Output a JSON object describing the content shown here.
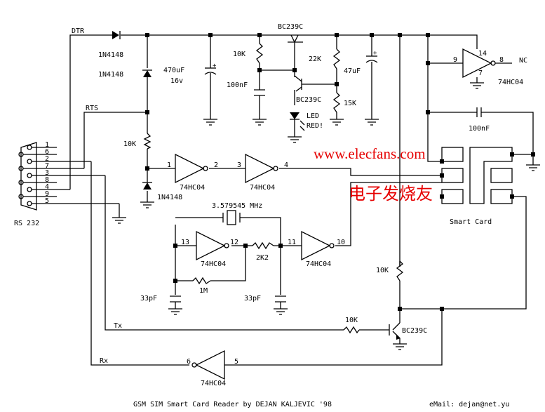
{
  "title": "GSM SIM Smart Card Reader by DEJAN KALJEVIC '98",
  "email": "eMail: dejan@net.yu",
  "watermark": {
    "url": "www.elecfans.com",
    "cn": "电子发烧友",
    "color": "#e60000"
  },
  "signals": {
    "dtr": "DTR",
    "rts": "RTS",
    "tx": "Tx",
    "rx": "Rx"
  },
  "connector": {
    "label": "RS 232",
    "pins": [
      "1",
      "6",
      "2",
      "7",
      "3",
      "8",
      "4",
      "9",
      "5"
    ]
  },
  "components": {
    "d1": "1N4148",
    "d2": "1N4148",
    "d3": "1N4148",
    "c_470": "470uF",
    "c_470_v": "16v",
    "r_10k_top": "10K",
    "c_100n_top": "100nF",
    "q1": "BC239C",
    "q2": "BC239C",
    "r_22k": "22K",
    "r_15k": "15K",
    "c_47u": "47uF",
    "led": "LED",
    "led_color": "RED!",
    "r_10k_rts": "10K",
    "crystal": "3.579545 MHz",
    "r_2k2": "2K2",
    "r_1m": "1M",
    "c_33p_a": "33pF",
    "c_33p_b": "33pF",
    "r_10k_mid": "10K",
    "r_10k_tx": "10K",
    "q3": "BC239C",
    "c_100n_right": "100nF",
    "smart_card": "Smart Card",
    "nc": "NC"
  },
  "gates": [
    {
      "part": "74HC04",
      "in": "1",
      "out": "2"
    },
    {
      "part": "74HC04",
      "in": "3",
      "out": "4"
    },
    {
      "part": "74HC04",
      "in": "13",
      "out": "12"
    },
    {
      "part": "74HC04",
      "in": "11",
      "out": "10"
    },
    {
      "part": "74HC04",
      "in": "5",
      "out": "6"
    },
    {
      "part": "74HC04",
      "in": "9",
      "out": "8",
      "vcc": "14",
      "gnd": "7"
    }
  ]
}
